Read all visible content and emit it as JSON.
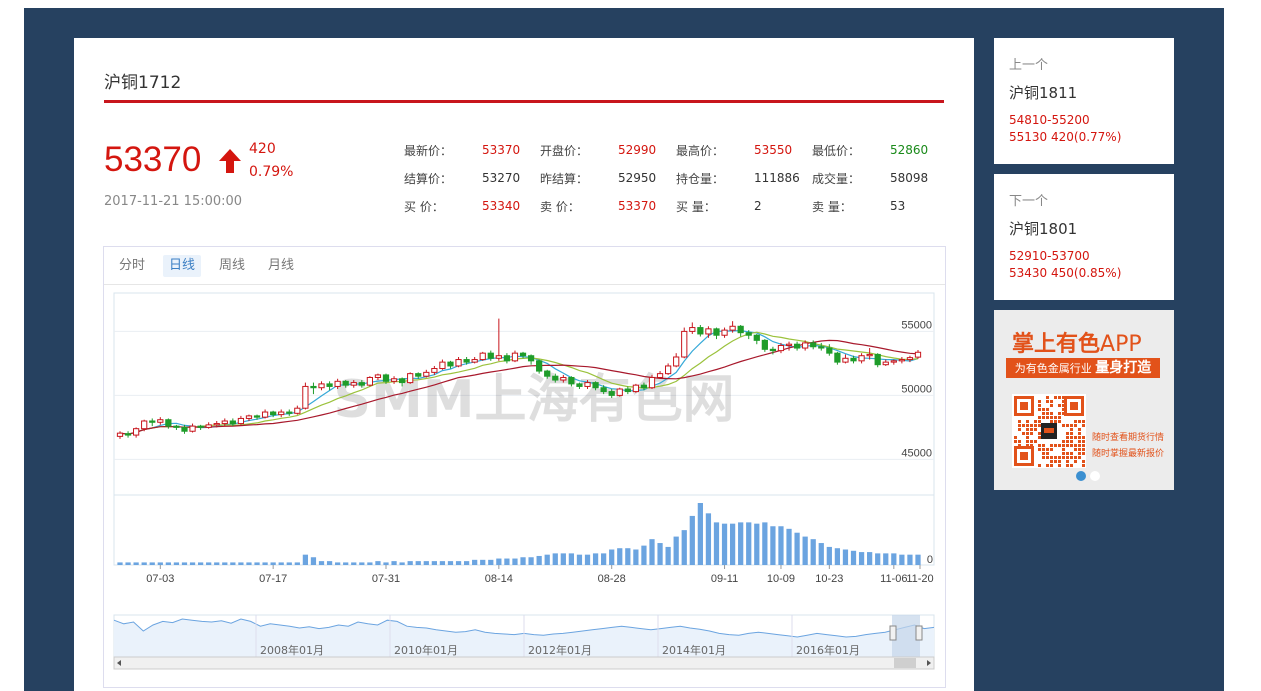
{
  "contract": {
    "title": "沪铜1712",
    "price": "53370",
    "change": "420",
    "change_pct": "0.79%",
    "datetime": "2017-11-21 15:00:00"
  },
  "stats": [
    [
      {
        "label": "最新价：",
        "value": "53370",
        "color": "red"
      },
      {
        "label": "开盘价：",
        "value": "52990",
        "color": "red"
      },
      {
        "label": "最高价：",
        "value": "53550",
        "color": "red"
      },
      {
        "label": "最低价：",
        "value": "52860",
        "color": "green"
      }
    ],
    [
      {
        "label": "结算价：",
        "value": "53270",
        "color": "dark"
      },
      {
        "label": "昨结算：",
        "value": "52950",
        "color": "dark"
      },
      {
        "label": "持仓量：",
        "value": "111886",
        "color": "dark"
      },
      {
        "label": "成交量：",
        "value": "58098",
        "color": "dark"
      }
    ],
    [
      {
        "label": "买  价：",
        "value": "53340",
        "color": "red"
      },
      {
        "label": "卖  价：",
        "value": "53370",
        "color": "red"
      },
      {
        "label": "买  量：",
        "value": "2",
        "color": "dark"
      },
      {
        "label": "卖  量：",
        "value": "53",
        "color": "dark"
      }
    ]
  ],
  "tabs": [
    "分时",
    "日线",
    "周线",
    "月线"
  ],
  "active_tab": 1,
  "watermark": "SMM上海有色网",
  "chart_data": {
    "type": "candlestick",
    "x_ticks": [
      "07-03",
      "07-17",
      "07-31",
      "08-14",
      "08-28",
      "09-11",
      "10-09",
      "10-23",
      "11-06",
      "11-20"
    ],
    "y_ticks": [
      "55000",
      "50000",
      "45000"
    ],
    "ylim": [
      43000,
      58000
    ],
    "volume_label": "0",
    "candles": [
      [
        46800,
        47050,
        46600,
        47200
      ],
      [
        47000,
        46900,
        46700,
        47200
      ],
      [
        46900,
        47400,
        46700,
        47500
      ],
      [
        47400,
        48000,
        47200,
        48100
      ],
      [
        48000,
        47900,
        47600,
        48200
      ],
      [
        47900,
        48100,
        47700,
        48300
      ],
      [
        48100,
        47600,
        47400,
        48200
      ],
      [
        47600,
        47500,
        47300,
        47700
      ],
      [
        47500,
        47200,
        47000,
        47700
      ],
      [
        47200,
        47600,
        47100,
        47800
      ],
      [
        47600,
        47500,
        47300,
        47700
      ],
      [
        47500,
        47700,
        47400,
        47900
      ],
      [
        47700,
        47800,
        47500,
        48000
      ],
      [
        47800,
        48000,
        47600,
        48200
      ],
      [
        48000,
        47800,
        47600,
        48200
      ],
      [
        47800,
        48200,
        47700,
        48400
      ],
      [
        48200,
        48400,
        48000,
        48500
      ],
      [
        48400,
        48300,
        48100,
        48500
      ],
      [
        48300,
        48700,
        48200,
        48900
      ],
      [
        48700,
        48500,
        48300,
        48800
      ],
      [
        48500,
        48700,
        48300,
        48900
      ],
      [
        48700,
        48600,
        48400,
        48900
      ],
      [
        48600,
        49000,
        48500,
        49200
      ],
      [
        49000,
        50700,
        48900,
        51000
      ],
      [
        50700,
        50600,
        50100,
        51000
      ],
      [
        50600,
        50900,
        50400,
        51100
      ],
      [
        50900,
        50700,
        50400,
        51100
      ],
      [
        50700,
        51100,
        50500,
        51300
      ],
      [
        51100,
        50800,
        50600,
        51200
      ],
      [
        50800,
        51000,
        50600,
        51200
      ],
      [
        51000,
        50800,
        50600,
        51200
      ],
      [
        50800,
        51400,
        50700,
        51500
      ],
      [
        51400,
        51600,
        51200,
        51700
      ],
      [
        51600,
        51100,
        50900,
        51700
      ],
      [
        51100,
        51300,
        50900,
        51500
      ],
      [
        51300,
        51000,
        50700,
        51400
      ],
      [
        51000,
        51700,
        50900,
        51800
      ],
      [
        51700,
        51500,
        51300,
        51800
      ],
      [
        51500,
        51800,
        51400,
        52000
      ],
      [
        51800,
        52100,
        51600,
        52300
      ],
      [
        52100,
        52600,
        52000,
        52800
      ],
      [
        52600,
        52300,
        52100,
        52700
      ],
      [
        52300,
        52800,
        52200,
        53000
      ],
      [
        52800,
        52600,
        52400,
        53000
      ],
      [
        52600,
        52800,
        52500,
        53000
      ],
      [
        52800,
        53300,
        52700,
        53400
      ],
      [
        53300,
        52900,
        52700,
        53500
      ],
      [
        52900,
        53100,
        52700,
        56000
      ],
      [
        53100,
        52700,
        52500,
        53300
      ],
      [
        52700,
        53300,
        52600,
        53500
      ],
      [
        53300,
        53100,
        52900,
        53400
      ],
      [
        53100,
        52700,
        52400,
        53200
      ],
      [
        52700,
        51900,
        51700,
        52800
      ],
      [
        51900,
        51500,
        51300,
        52000
      ],
      [
        51500,
        51200,
        51000,
        51700
      ],
      [
        51200,
        51400,
        51000,
        51600
      ],
      [
        51400,
        50900,
        50700,
        51500
      ],
      [
        50900,
        50700,
        50500,
        51000
      ],
      [
        50700,
        51000,
        50500,
        51200
      ],
      [
        51000,
        50600,
        50400,
        51100
      ],
      [
        50600,
        50300,
        50100,
        50800
      ],
      [
        50300,
        50000,
        49800,
        50500
      ],
      [
        50000,
        50500,
        49900,
        50600
      ],
      [
        50500,
        50300,
        50100,
        50700
      ],
      [
        50300,
        50800,
        50200,
        50900
      ],
      [
        50800,
        50600,
        50400,
        51000
      ],
      [
        50600,
        51400,
        50500,
        51600
      ],
      [
        51400,
        51700,
        51300,
        51900
      ],
      [
        51700,
        52300,
        51600,
        52500
      ],
      [
        52300,
        53000,
        52200,
        53300
      ],
      [
        53000,
        55000,
        52900,
        55300
      ],
      [
        55000,
        55300,
        54800,
        55700
      ],
      [
        55300,
        54800,
        54600,
        55500
      ],
      [
        54800,
        55200,
        54500,
        55400
      ],
      [
        55200,
        54700,
        54400,
        55300
      ],
      [
        54700,
        55100,
        54500,
        55300
      ],
      [
        55100,
        55400,
        54900,
        55800
      ],
      [
        55400,
        54900,
        54600,
        55500
      ],
      [
        54900,
        54700,
        54400,
        55100
      ],
      [
        54700,
        54300,
        54000,
        54800
      ],
      [
        54300,
        53600,
        53400,
        54400
      ],
      [
        53600,
        53500,
        53200,
        53800
      ],
      [
        53500,
        53900,
        53300,
        54100
      ],
      [
        53900,
        54000,
        53500,
        54200
      ],
      [
        54000,
        53700,
        53500,
        54200
      ],
      [
        53700,
        54100,
        53500,
        54300
      ],
      [
        54100,
        53800,
        53600,
        54300
      ],
      [
        53800,
        53700,
        53500,
        54100
      ],
      [
        53700,
        53300,
        53100,
        54000
      ],
      [
        53300,
        52600,
        52400,
        53400
      ],
      [
        52600,
        52900,
        52500,
        53200
      ],
      [
        52900,
        52700,
        52500,
        53100
      ],
      [
        52700,
        53100,
        52500,
        53300
      ],
      [
        53100,
        53200,
        52800,
        53700
      ],
      [
        53200,
        52400,
        52200,
        53300
      ],
      [
        52400,
        52600,
        52300,
        52800
      ],
      [
        52600,
        52700,
        52400,
        52800
      ],
      [
        52700,
        52800,
        52500,
        53000
      ],
      [
        52800,
        52950,
        52600,
        53100
      ],
      [
        52990,
        53370,
        52860,
        53550
      ]
    ],
    "volumes": [
      2,
      2,
      2,
      2,
      2,
      2,
      2,
      2,
      2,
      2,
      2,
      2,
      2,
      2,
      2,
      2,
      2,
      2,
      2,
      2,
      2,
      2,
      2,
      8,
      6,
      3,
      3,
      2,
      2,
      2,
      2,
      2,
      3,
      2,
      3,
      2,
      3,
      3,
      3,
      3,
      3,
      3,
      3,
      3,
      4,
      4,
      4,
      5,
      5,
      5,
      6,
      6,
      7,
      8,
      9,
      9,
      9,
      8,
      8,
      9,
      9,
      12,
      13,
      13,
      12,
      15,
      20,
      17,
      14,
      22,
      27,
      38,
      48,
      40,
      33,
      32,
      32,
      33,
      33,
      32,
      33,
      30,
      30,
      28,
      25,
      22,
      20,
      17,
      14,
      13,
      12,
      11,
      10,
      10,
      9,
      9,
      9,
      8,
      8,
      8,
      7,
      6,
      7
    ]
  },
  "navigator": {
    "labels": [
      "2008年01月",
      "2010年01月",
      "2012年01月",
      "2014年01月",
      "2016年01月"
    ],
    "series": [
      58,
      52,
      55,
      40,
      50,
      56,
      54,
      60,
      58,
      56,
      55,
      57,
      53,
      60,
      56,
      48,
      52,
      50,
      48,
      45,
      47,
      44,
      46,
      50,
      48,
      55,
      52,
      50,
      58,
      56,
      48,
      46,
      45,
      42,
      40,
      38,
      39,
      42,
      38,
      36,
      35,
      34,
      36,
      34,
      33,
      35,
      36,
      38,
      40,
      42,
      44,
      46,
      48,
      46,
      44,
      42,
      44,
      46,
      48,
      45,
      43,
      40,
      36,
      34,
      33,
      36,
      38,
      36,
      34,
      32,
      30,
      33,
      36,
      34,
      32,
      30,
      31,
      34,
      36,
      38,
      42,
      46,
      50,
      44,
      46
    ]
  },
  "side_prev": {
    "label": "上一个",
    "name": "沪铜1811",
    "range": "54810-55200",
    "quote": "55130 420(0.77%)"
  },
  "side_next": {
    "label": "下一个",
    "name": "沪铜1801",
    "range": "52910-53700",
    "quote": "53430 450(0.85%)"
  },
  "ad": {
    "title_main": "掌上有色",
    "title_app": "APP",
    "banner_small": "为有色金属行业",
    "banner_big": "量身打造",
    "line1": "随时查看期货行情",
    "line2": "随时掌握最新报价"
  }
}
